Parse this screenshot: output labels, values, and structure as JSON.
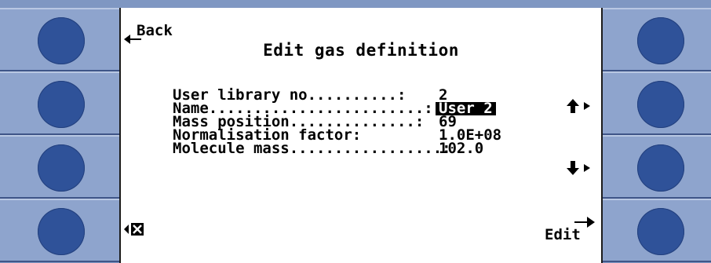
{
  "header": {
    "back_label": "Back",
    "title": "Edit gas definition"
  },
  "fields": [
    {
      "label": "User library no..........:",
      "value": "2"
    },
    {
      "label": "Name........................:",
      "value": "User 2"
    },
    {
      "label": "Mass position..............:",
      "value": "69"
    },
    {
      "label": "Normalisation factor:",
      "value": "1.0E+08"
    },
    {
      "label": "Molecule mass.................:",
      "value": "102.0"
    }
  ],
  "softkeys": {
    "up_icon": "arrow-up-icon",
    "down_icon": "arrow-down-icon",
    "cancel_icon": "close-box-icon",
    "edit_label": "Edit"
  },
  "colors": {
    "bezel": "#7f97c2",
    "button": "#2f5299",
    "screen_bg": "#ffffff"
  }
}
